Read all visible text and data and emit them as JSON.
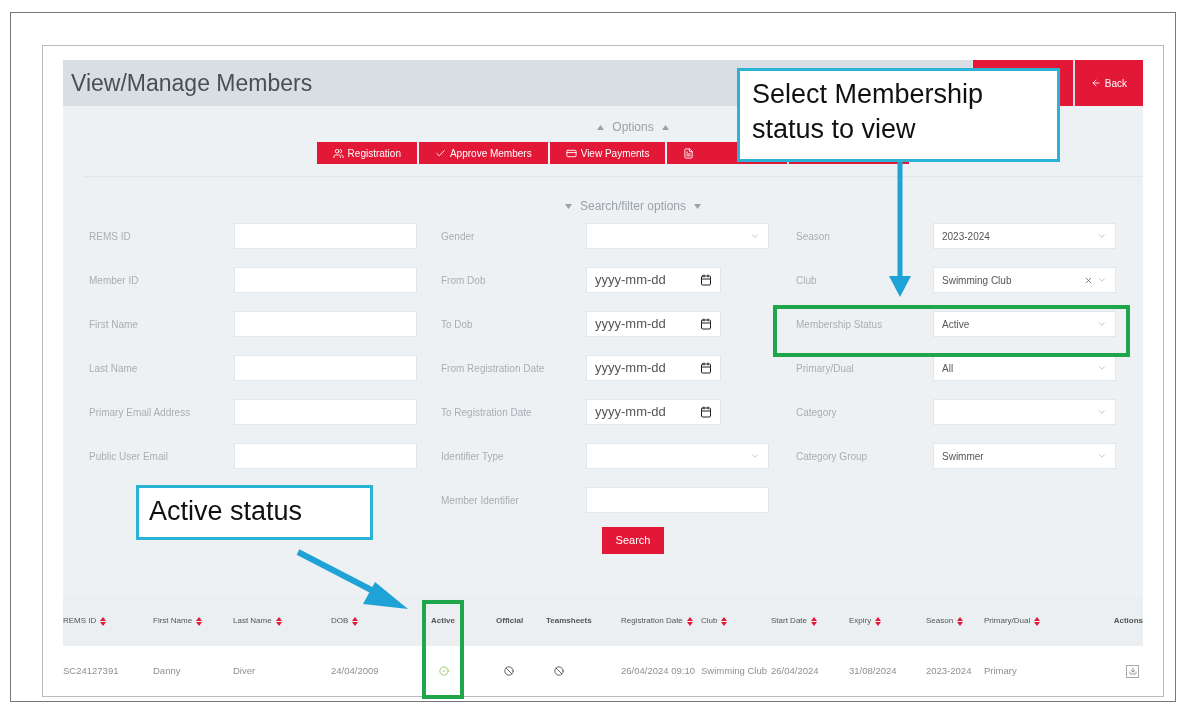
{
  "page": {
    "title": "View/Manage Members",
    "back_button": "Back"
  },
  "options": {
    "toggle": "Options",
    "buttons": [
      {
        "label": "Registration",
        "kind": "users"
      },
      {
        "label": "Approve Members",
        "kind": "check"
      },
      {
        "label": "View Payments",
        "kind": "card"
      },
      {
        "kind": "file"
      },
      {
        "kind": "plain"
      }
    ]
  },
  "filters": {
    "toggle": "Search/filter options",
    "columns": [
      [
        {
          "label": "REMS ID",
          "kind": "text"
        },
        {
          "label": "Member ID",
          "kind": "text"
        },
        {
          "label": "First Name",
          "kind": "text"
        },
        {
          "label": "Last Name",
          "kind": "text"
        },
        {
          "label": "Primary Email Address",
          "kind": "text"
        },
        {
          "label": "Public User Email",
          "kind": "text"
        }
      ],
      [
        {
          "label": "Gender",
          "kind": "select"
        },
        {
          "label": "From Dob",
          "kind": "date",
          "value": "yyyy-mm-dd"
        },
        {
          "label": "To Dob",
          "kind": "date",
          "value": "yyyy-mm-dd"
        },
        {
          "label": "From Registration Date",
          "kind": "date",
          "value": "yyyy-mm-dd"
        },
        {
          "label": "To Registration Date",
          "kind": "date",
          "value": "yyyy-mm-dd"
        },
        {
          "label": "Identifier Type",
          "kind": "select"
        },
        {
          "label": "Member Identifier",
          "kind": "text"
        }
      ],
      [
        {
          "label": "Season",
          "kind": "select",
          "value": "2023-2024"
        },
        {
          "label": "Club",
          "kind": "select",
          "value": "Swimming Club",
          "clearable": true
        },
        {
          "label": "Membership Status",
          "kind": "select",
          "value": "Active"
        },
        {
          "label": "Primary/Dual",
          "kind": "select",
          "value": "All"
        },
        {
          "label": "Category",
          "kind": "select"
        },
        {
          "label": "Category Group",
          "kind": "select",
          "value": "Swimmer"
        }
      ]
    ],
    "search_button": "Search"
  },
  "table": {
    "columns": [
      {
        "label": "REMS ID",
        "sortable": true
      },
      {
        "label": "First Name",
        "sortable": true
      },
      {
        "label": "Last Name",
        "sortable": true
      },
      {
        "label": "DOB",
        "sortable": true
      },
      {
        "label": "Active",
        "sortable": false
      },
      {
        "label": "Official",
        "sortable": false
      },
      {
        "label": "Teamsheets",
        "sortable": false
      },
      {
        "label": "Registration Date",
        "sortable": true
      },
      {
        "label": "Club",
        "sortable": true
      },
      {
        "label": "Start Date",
        "sortable": true
      },
      {
        "label": "Expiry",
        "sortable": true
      },
      {
        "label": "Season",
        "sortable": true
      },
      {
        "label": "Primary/Dual",
        "sortable": true
      },
      {
        "label": "Actions",
        "sortable": false
      }
    ],
    "rows": [
      [
        {
          "kind": "text",
          "text": "SC24127391"
        },
        {
          "kind": "text",
          "text": "Danny"
        },
        {
          "kind": "text",
          "text": "Diver"
        },
        {
          "kind": "text",
          "text": "24/04/2009"
        },
        {
          "kind": "flag",
          "on": true
        },
        {
          "kind": "flag",
          "on": false
        },
        {
          "kind": "flag",
          "on": false
        },
        {
          "kind": "text",
          "text": "26/04/2024 09:10"
        },
        {
          "kind": "text",
          "text": "Swimming Club"
        },
        {
          "kind": "text",
          "text": "26/04/2024"
        },
        {
          "kind": "text",
          "text": "31/08/2024"
        },
        {
          "kind": "text",
          "text": "2023-2024"
        },
        {
          "kind": "text",
          "text": "Primary"
        },
        {
          "kind": "action"
        }
      ]
    ]
  },
  "callouts": [
    {
      "text": "Select Membership status to view"
    },
    {
      "text": "Active status"
    }
  ]
}
